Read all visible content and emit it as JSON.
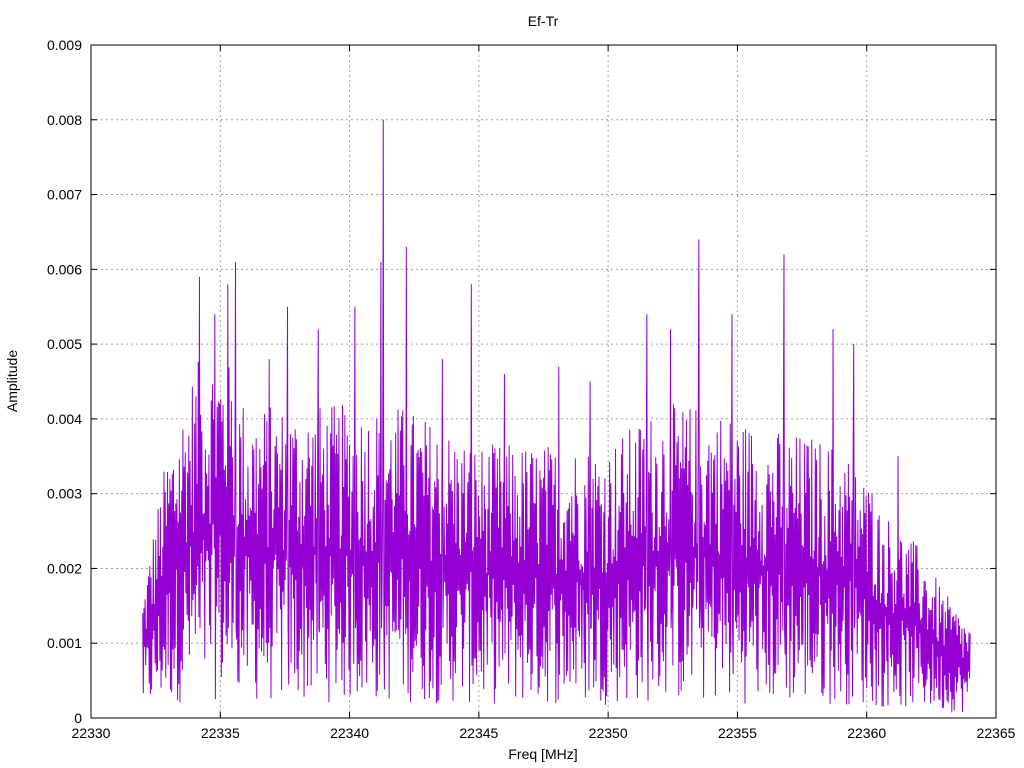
{
  "chart_data": {
    "type": "line",
    "title": "Ef-Tr",
    "xlabel": "Freq [MHz]",
    "ylabel": "Amplitude",
    "xlim": [
      22330,
      22365
    ],
    "ylim": [
      0,
      0.009
    ],
    "grid": true,
    "xticks": [
      22330,
      22335,
      22340,
      22345,
      22350,
      22355,
      22360,
      22365
    ],
    "yticks": [
      0,
      0.001,
      0.002,
      0.003,
      0.004,
      0.005,
      0.006,
      0.007,
      0.008,
      0.009
    ],
    "xtick_labels": [
      "22330",
      "22335",
      "22340",
      "22345",
      "22350",
      "22355",
      "22360",
      "22365"
    ],
    "ytick_labels": [
      "0",
      "0.001",
      "0.002",
      "0.003",
      "0.004",
      "0.005",
      "0.006",
      "0.007",
      "0.008",
      "0.009"
    ],
    "series": [
      {
        "color": "#9400d3",
        "x_range": [
          22332.0,
          22364.0
        ],
        "envelope": [
          {
            "x": 22332.0,
            "y": 0.0016
          },
          {
            "x": 22332.5,
            "y": 0.0026
          },
          {
            "x": 22333.0,
            "y": 0.0035
          },
          {
            "x": 22333.5,
            "y": 0.004
          },
          {
            "x": 22334.0,
            "y": 0.0045
          },
          {
            "x": 22335.0,
            "y": 0.0048
          },
          {
            "x": 22336.0,
            "y": 0.004
          },
          {
            "x": 22338.0,
            "y": 0.004
          },
          {
            "x": 22340.0,
            "y": 0.004
          },
          {
            "x": 22342.0,
            "y": 0.004
          },
          {
            "x": 22345.0,
            "y": 0.0035
          },
          {
            "x": 22348.0,
            "y": 0.0035
          },
          {
            "x": 22350.0,
            "y": 0.0035
          },
          {
            "x": 22352.0,
            "y": 0.004
          },
          {
            "x": 22354.0,
            "y": 0.004
          },
          {
            "x": 22356.0,
            "y": 0.0037
          },
          {
            "x": 22358.0,
            "y": 0.0036
          },
          {
            "x": 22359.5,
            "y": 0.0034
          },
          {
            "x": 22360.5,
            "y": 0.0027
          },
          {
            "x": 22362.0,
            "y": 0.0022
          },
          {
            "x": 22363.0,
            "y": 0.0016
          },
          {
            "x": 22364.0,
            "y": 0.0012
          }
        ],
        "peaks": [
          {
            "x": 22334.2,
            "y": 0.0059
          },
          {
            "x": 22334.8,
            "y": 0.0054
          },
          {
            "x": 22335.3,
            "y": 0.0058
          },
          {
            "x": 22335.6,
            "y": 0.0061
          },
          {
            "x": 22336.9,
            "y": 0.0048
          },
          {
            "x": 22337.6,
            "y": 0.0055
          },
          {
            "x": 22338.8,
            "y": 0.0052
          },
          {
            "x": 22340.2,
            "y": 0.0055
          },
          {
            "x": 22341.3,
            "y": 0.008
          },
          {
            "x": 22341.2,
            "y": 0.0061
          },
          {
            "x": 22342.2,
            "y": 0.0063
          },
          {
            "x": 22343.6,
            "y": 0.0048
          },
          {
            "x": 22344.7,
            "y": 0.0058
          },
          {
            "x": 22346.0,
            "y": 0.0046
          },
          {
            "x": 22348.1,
            "y": 0.0047
          },
          {
            "x": 22349.3,
            "y": 0.0045
          },
          {
            "x": 22351.5,
            "y": 0.0054
          },
          {
            "x": 22352.4,
            "y": 0.0052
          },
          {
            "x": 22353.5,
            "y": 0.0064
          },
          {
            "x": 22354.8,
            "y": 0.0054
          },
          {
            "x": 22356.8,
            "y": 0.0062
          },
          {
            "x": 22358.7,
            "y": 0.0052
          },
          {
            "x": 22359.5,
            "y": 0.005
          },
          {
            "x": 22360.2,
            "y": 0.003
          },
          {
            "x": 22361.2,
            "y": 0.0035
          }
        ]
      }
    ]
  }
}
